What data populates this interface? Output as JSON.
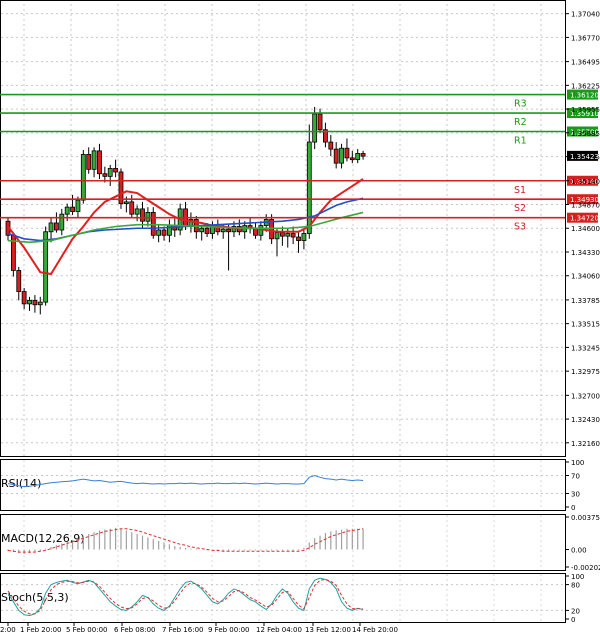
{
  "chart_data": {
    "type": "candlestick",
    "timeframe": "H4",
    "x_labels": [
      "2:00",
      "1 Feb 20:00",
      "5 Feb 00:00",
      "6 Feb 08:00",
      "7 Feb 16:00",
      "9 Feb 00:00",
      "12 Feb 04:00",
      "13 Feb 12:00",
      "14 Feb 20:00"
    ],
    "price_axis": {
      "ticks": [
        "1.37040",
        "1.36770",
        "1.36495",
        "1.36225",
        "1.35955",
        "1.35685",
        "1.35415",
        "1.35140",
        "1.34870",
        "1.34600",
        "1.34330",
        "1.34060",
        "1.33785",
        "1.33515",
        "1.33245",
        "1.32975",
        "1.32700",
        "1.32430",
        "1.32160"
      ],
      "ylim": [
        1.3201,
        1.3715
      ],
      "last_price": "1.35423"
    },
    "levels": [
      {
        "name": "R3",
        "value": 1.3612,
        "label": "1.36120",
        "color": "#1a9a1a"
      },
      {
        "name": "R2",
        "value": 1.3591,
        "label": "1.35910",
        "color": "#1a9a1a"
      },
      {
        "name": "R1",
        "value": 1.357,
        "label": "1.35700",
        "color": "#1a9a1a"
      },
      {
        "name": "S1",
        "value": 1.3514,
        "label": "1.35140",
        "color": "#d42020"
      },
      {
        "name": "S2",
        "value": 1.3493,
        "label": "1.34930",
        "color": "#d42020"
      },
      {
        "name": "S3",
        "value": 1.3472,
        "label": "1.34720",
        "color": "#d42020"
      }
    ],
    "candles": [
      {
        "o": 1.3468,
        "h": 1.3472,
        "l": 1.3446,
        "c": 1.3452
      },
      {
        "o": 1.3452,
        "h": 1.3454,
        "l": 1.3405,
        "c": 1.3412
      },
      {
        "o": 1.3412,
        "h": 1.3416,
        "l": 1.3378,
        "c": 1.3388
      },
      {
        "o": 1.3388,
        "h": 1.3392,
        "l": 1.3368,
        "c": 1.3374
      },
      {
        "o": 1.3374,
        "h": 1.3382,
        "l": 1.3366,
        "c": 1.3378
      },
      {
        "o": 1.3378,
        "h": 1.3384,
        "l": 1.3364,
        "c": 1.3373
      },
      {
        "o": 1.3373,
        "h": 1.3382,
        "l": 1.3362,
        "c": 1.3376
      },
      {
        "o": 1.3376,
        "h": 1.3462,
        "l": 1.3372,
        "c": 1.3456
      },
      {
        "o": 1.3456,
        "h": 1.3472,
        "l": 1.3444,
        "c": 1.3466
      },
      {
        "o": 1.3466,
        "h": 1.3478,
        "l": 1.3455,
        "c": 1.3458
      },
      {
        "o": 1.3458,
        "h": 1.3482,
        "l": 1.3452,
        "c": 1.3476
      },
      {
        "o": 1.3476,
        "h": 1.3488,
        "l": 1.3468,
        "c": 1.3484
      },
      {
        "o": 1.3484,
        "h": 1.3498,
        "l": 1.3475,
        "c": 1.3479
      },
      {
        "o": 1.3479,
        "h": 1.3496,
        "l": 1.3472,
        "c": 1.3492
      },
      {
        "o": 1.3492,
        "h": 1.3549,
        "l": 1.3488,
        "c": 1.3544
      },
      {
        "o": 1.3544,
        "h": 1.3552,
        "l": 1.3522,
        "c": 1.3527
      },
      {
        "o": 1.3527,
        "h": 1.3552,
        "l": 1.3518,
        "c": 1.3548
      },
      {
        "o": 1.3548,
        "h": 1.3556,
        "l": 1.3516,
        "c": 1.3522
      },
      {
        "o": 1.3522,
        "h": 1.353,
        "l": 1.3512,
        "c": 1.3519
      },
      {
        "o": 1.3519,
        "h": 1.3532,
        "l": 1.3508,
        "c": 1.3528
      },
      {
        "o": 1.3528,
        "h": 1.3538,
        "l": 1.3518,
        "c": 1.3524
      },
      {
        "o": 1.3524,
        "h": 1.3528,
        "l": 1.3482,
        "c": 1.3488
      },
      {
        "o": 1.3488,
        "h": 1.3496,
        "l": 1.3478,
        "c": 1.349
      },
      {
        "o": 1.349,
        "h": 1.3498,
        "l": 1.3472,
        "c": 1.3476
      },
      {
        "o": 1.3476,
        "h": 1.3486,
        "l": 1.3468,
        "c": 1.3482
      },
      {
        "o": 1.3482,
        "h": 1.349,
        "l": 1.346,
        "c": 1.3468
      },
      {
        "o": 1.3468,
        "h": 1.3484,
        "l": 1.3462,
        "c": 1.3478
      },
      {
        "o": 1.3478,
        "h": 1.3484,
        "l": 1.3448,
        "c": 1.3452
      },
      {
        "o": 1.3452,
        "h": 1.3464,
        "l": 1.3444,
        "c": 1.3458
      },
      {
        "o": 1.3458,
        "h": 1.3462,
        "l": 1.3446,
        "c": 1.3452
      },
      {
        "o": 1.3452,
        "h": 1.347,
        "l": 1.3444,
        "c": 1.3463
      },
      {
        "o": 1.3463,
        "h": 1.3474,
        "l": 1.345,
        "c": 1.3458
      },
      {
        "o": 1.3458,
        "h": 1.3488,
        "l": 1.3452,
        "c": 1.3482
      },
      {
        "o": 1.3482,
        "h": 1.349,
        "l": 1.3458,
        "c": 1.3463
      },
      {
        "o": 1.3463,
        "h": 1.3478,
        "l": 1.3455,
        "c": 1.347
      },
      {
        "o": 1.347,
        "h": 1.3474,
        "l": 1.3448,
        "c": 1.3456
      },
      {
        "o": 1.3456,
        "h": 1.3464,
        "l": 1.3446,
        "c": 1.346
      },
      {
        "o": 1.346,
        "h": 1.3466,
        "l": 1.345,
        "c": 1.3454
      },
      {
        "o": 1.3454,
        "h": 1.3468,
        "l": 1.3448,
        "c": 1.3462
      },
      {
        "o": 1.3462,
        "h": 1.347,
        "l": 1.3452,
        "c": 1.3456
      },
      {
        "o": 1.3456,
        "h": 1.3464,
        "l": 1.3448,
        "c": 1.3459
      },
      {
        "o": 1.3459,
        "h": 1.3464,
        "l": 1.3412,
        "c": 1.3456
      },
      {
        "o": 1.3456,
        "h": 1.3468,
        "l": 1.345,
        "c": 1.3462
      },
      {
        "o": 1.3462,
        "h": 1.347,
        "l": 1.3452,
        "c": 1.3456
      },
      {
        "o": 1.3456,
        "h": 1.3468,
        "l": 1.3448,
        "c": 1.3463
      },
      {
        "o": 1.3463,
        "h": 1.3472,
        "l": 1.3454,
        "c": 1.346
      },
      {
        "o": 1.346,
        "h": 1.3466,
        "l": 1.3448,
        "c": 1.3452
      },
      {
        "o": 1.3452,
        "h": 1.3468,
        "l": 1.3446,
        "c": 1.3463
      },
      {
        "o": 1.3463,
        "h": 1.3476,
        "l": 1.3456,
        "c": 1.347
      },
      {
        "o": 1.347,
        "h": 1.3476,
        "l": 1.3442,
        "c": 1.3448
      },
      {
        "o": 1.3448,
        "h": 1.346,
        "l": 1.3428,
        "c": 1.3455
      },
      {
        "o": 1.3455,
        "h": 1.3462,
        "l": 1.344,
        "c": 1.3451
      },
      {
        "o": 1.3451,
        "h": 1.346,
        "l": 1.3438,
        "c": 1.3454
      },
      {
        "o": 1.3454,
        "h": 1.3462,
        "l": 1.3442,
        "c": 1.345
      },
      {
        "o": 1.345,
        "h": 1.3456,
        "l": 1.3432,
        "c": 1.3446
      },
      {
        "o": 1.3446,
        "h": 1.346,
        "l": 1.3436,
        "c": 1.3454
      },
      {
        "o": 1.3454,
        "h": 1.3578,
        "l": 1.3448,
        "c": 1.3558
      },
      {
        "o": 1.3558,
        "h": 1.3598,
        "l": 1.355,
        "c": 1.359
      },
      {
        "o": 1.359,
        "h": 1.3596,
        "l": 1.3568,
        "c": 1.3572
      },
      {
        "o": 1.3572,
        "h": 1.358,
        "l": 1.3552,
        "c": 1.3558
      },
      {
        "o": 1.3558,
        "h": 1.3566,
        "l": 1.3542,
        "c": 1.355
      },
      {
        "o": 1.355,
        "h": 1.3558,
        "l": 1.3528,
        "c": 1.3534
      },
      {
        "o": 1.3534,
        "h": 1.3556,
        "l": 1.3528,
        "c": 1.3551
      },
      {
        "o": 1.3551,
        "h": 1.3562,
        "l": 1.3536,
        "c": 1.354
      },
      {
        "o": 1.354,
        "h": 1.3548,
        "l": 1.3534,
        "c": 1.3538
      },
      {
        "o": 1.3538,
        "h": 1.355,
        "l": 1.3534,
        "c": 1.3545
      },
      {
        "o": 1.3545,
        "h": 1.3548,
        "l": 1.3538,
        "c": 1.3542
      }
    ],
    "moving_averages": [
      {
        "color": "#e02020",
        "points": [
          [
            0,
            1.3462
          ],
          [
            3,
            1.3438
          ],
          [
            6,
            1.341
          ],
          [
            8,
            1.3408
          ],
          [
            10,
            1.3428
          ],
          [
            12,
            1.3448
          ],
          [
            14,
            1.3462
          ],
          [
            16,
            1.3478
          ],
          [
            18,
            1.349
          ],
          [
            20,
            1.3496
          ],
          [
            22,
            1.3502
          ],
          [
            24,
            1.35
          ],
          [
            26,
            1.3492
          ],
          [
            28,
            1.3484
          ],
          [
            30,
            1.3476
          ],
          [
            32,
            1.347
          ],
          [
            34,
            1.3468
          ],
          [
            36,
            1.3466
          ],
          [
            38,
            1.3463
          ],
          [
            40,
            1.3462
          ],
          [
            42,
            1.346
          ],
          [
            44,
            1.346
          ],
          [
            46,
            1.346
          ],
          [
            48,
            1.3458
          ],
          [
            50,
            1.3456
          ],
          [
            52,
            1.3456
          ],
          [
            54,
            1.3456
          ],
          [
            56,
            1.3462
          ],
          [
            58,
            1.3478
          ],
          [
            60,
            1.3492
          ],
          [
            62,
            1.35
          ],
          [
            64,
            1.3508
          ],
          [
            66,
            1.3516
          ]
        ]
      },
      {
        "color": "#2050d0",
        "points": [
          [
            0,
            1.3454
          ],
          [
            3,
            1.3448
          ],
          [
            6,
            1.3446
          ],
          [
            9,
            1.3448
          ],
          [
            12,
            1.3452
          ],
          [
            15,
            1.3456
          ],
          [
            18,
            1.3458
          ],
          [
            21,
            1.3459
          ],
          [
            24,
            1.346
          ],
          [
            27,
            1.346
          ],
          [
            30,
            1.3461
          ],
          [
            33,
            1.3462
          ],
          [
            36,
            1.3463
          ],
          [
            39,
            1.3464
          ],
          [
            42,
            1.3465
          ],
          [
            45,
            1.3466
          ],
          [
            48,
            1.3467
          ],
          [
            51,
            1.3468
          ],
          [
            54,
            1.347
          ],
          [
            57,
            1.3474
          ],
          [
            59,
            1.348
          ],
          [
            61,
            1.3486
          ],
          [
            63,
            1.349
          ],
          [
            66,
            1.3494
          ]
        ]
      },
      {
        "color": "#3aa83a",
        "points": [
          [
            0,
            1.3446
          ],
          [
            4,
            1.3444
          ],
          [
            8,
            1.3446
          ],
          [
            12,
            1.3452
          ],
          [
            16,
            1.3458
          ],
          [
            20,
            1.3462
          ],
          [
            24,
            1.3464
          ],
          [
            28,
            1.3464
          ],
          [
            32,
            1.3463
          ],
          [
            36,
            1.3462
          ],
          [
            40,
            1.3461
          ],
          [
            44,
            1.346
          ],
          [
            48,
            1.346
          ],
          [
            52,
            1.346
          ],
          [
            56,
            1.3462
          ],
          [
            59,
            1.3467
          ],
          [
            62,
            1.3472
          ],
          [
            66,
            1.3478
          ]
        ]
      }
    ],
    "panels": [
      {
        "name": "RSI(14)",
        "axis_labels": [
          "100",
          "70",
          "30",
          "0"
        ],
        "range": [
          0,
          100
        ],
        "series_color": "#3a7fd8",
        "values": [
          52,
          50,
          47,
          45,
          46,
          48,
          50,
          52,
          54,
          55,
          56,
          57,
          58,
          60,
          62,
          60,
          58,
          59,
          57,
          55,
          56,
          57,
          55,
          53,
          52,
          53,
          52,
          51,
          52,
          51,
          52,
          52,
          53,
          52,
          53,
          52,
          51,
          52,
          52,
          53,
          52,
          52,
          53,
          52,
          53,
          52,
          51,
          52,
          53,
          52,
          51,
          52,
          52,
          51,
          51,
          52,
          66,
          70,
          66,
          63,
          62,
          60,
          62,
          60,
          59,
          60,
          59
        ]
      },
      {
        "name": "MACD(12,26,9)",
        "axis_labels": [
          "0.003754",
          "0.00",
          "-0.002021"
        ],
        "range": [
          -0.002021,
          0.003754
        ],
        "hist_color": "#a0a0a0",
        "signal_color": "#e03030",
        "histogram": [
          -0.0002,
          -0.0003,
          -0.0004,
          -0.0005,
          -0.0004,
          -0.0003,
          -0.0002,
          0.0001,
          0.0003,
          0.0005,
          0.0007,
          0.0009,
          0.0011,
          0.0013,
          0.0016,
          0.0018,
          0.002,
          0.0022,
          0.0023,
          0.0024,
          0.0025,
          0.0024,
          0.0022,
          0.002,
          0.0018,
          0.0016,
          0.0014,
          0.0012,
          0.001,
          0.0008,
          0.0006,
          0.0004,
          0.0003,
          0.0002,
          0.0001,
          0.0001,
          0.0,
          -0.0001,
          -0.0001,
          -0.0002,
          -0.0002,
          -0.0002,
          -0.0001,
          -0.0001,
          -0.0001,
          -0.0001,
          -0.0001,
          -0.0001,
          -0.0001,
          -0.0001,
          -0.0001,
          -0.0001,
          -0.0001,
          -0.0002,
          -0.0001,
          0.0002,
          0.0008,
          0.0013,
          0.0016,
          0.0019,
          0.0021,
          0.0022,
          0.0023,
          0.0024,
          0.0024,
          0.0024,
          0.0024
        ],
        "signal": [
          -0.0001,
          -0.0002,
          -0.0003,
          -0.0003,
          -0.0003,
          -0.0003,
          -0.0002,
          -0.0001,
          0.0001,
          0.0003,
          0.0005,
          0.0007,
          0.0009,
          0.0011,
          0.0013,
          0.0015,
          0.0017,
          0.0019,
          0.0021,
          0.0022,
          0.0023,
          0.0024,
          0.0024,
          0.0023,
          0.0022,
          0.002,
          0.0018,
          0.0016,
          0.0014,
          0.0012,
          0.001,
          0.0008,
          0.0006,
          0.0005,
          0.0003,
          0.0002,
          0.0001,
          0.0,
          -0.0001,
          -0.0001,
          -0.0002,
          -0.0002,
          -0.0002,
          -0.0002,
          -0.0002,
          -0.0002,
          -0.0002,
          -0.0002,
          -0.0002,
          -0.0002,
          -0.0002,
          -0.0002,
          -0.0002,
          -0.0002,
          -0.0002,
          -0.0001,
          0.0002,
          0.0006,
          0.0009,
          0.0012,
          0.0015,
          0.0017,
          0.0019,
          0.0021,
          0.0022,
          0.0023,
          0.0024
        ]
      },
      {
        "name": "Stoch(5,5,3)",
        "axis_labels": [
          "100",
          "80",
          "20",
          "0"
        ],
        "range": [
          0,
          100
        ],
        "main_color": "#20a0a0",
        "signal_color": "#e03030",
        "main": [
          60,
          40,
          20,
          10,
          8,
          12,
          25,
          60,
          80,
          85,
          88,
          90,
          85,
          82,
          86,
          90,
          85,
          70,
          55,
          40,
          30,
          22,
          20,
          28,
          40,
          55,
          50,
          35,
          25,
          20,
          30,
          50,
          70,
          85,
          88,
          80,
          70,
          55,
          40,
          35,
          45,
          60,
          70,
          65,
          55,
          45,
          40,
          30,
          22,
          35,
          55,
          70,
          60,
          40,
          25,
          20,
          70,
          90,
          95,
          92,
          85,
          70,
          40,
          25,
          20,
          25,
          22
        ],
        "signal": [
          65,
          48,
          30,
          18,
          12,
          12,
          20,
          45,
          68,
          80,
          85,
          88,
          87,
          84,
          85,
          88,
          86,
          76,
          62,
          48,
          36,
          28,
          24,
          26,
          35,
          48,
          50,
          42,
          32,
          25,
          28,
          42,
          60,
          76,
          84,
          82,
          74,
          62,
          48,
          40,
          42,
          52,
          64,
          66,
          60,
          50,
          44,
          36,
          28,
          32,
          46,
          62,
          64,
          48,
          32,
          24,
          50,
          78,
          90,
          92,
          88,
          78,
          55,
          35,
          24,
          24,
          23
        ]
      }
    ]
  }
}
